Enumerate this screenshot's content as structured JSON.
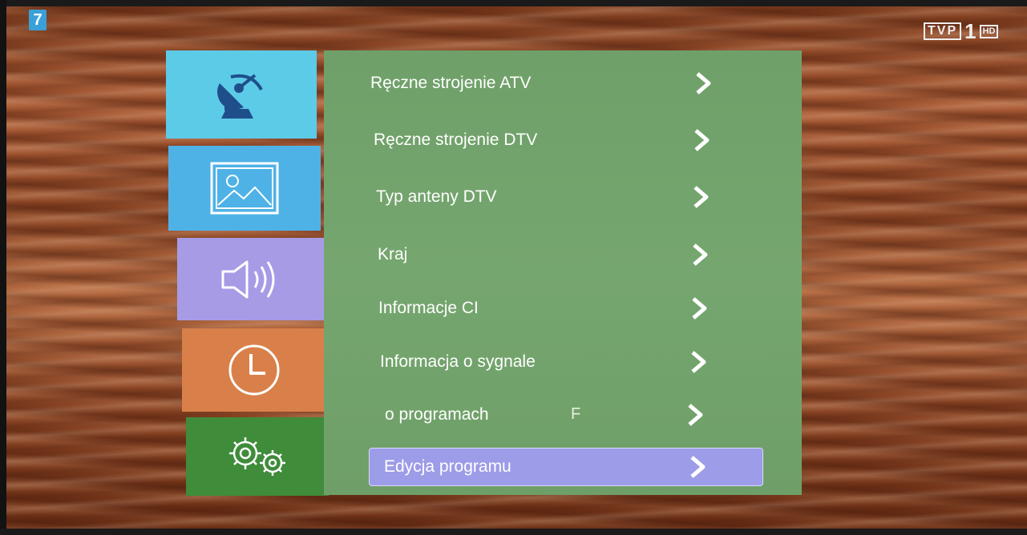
{
  "channel": {
    "number": "7"
  },
  "broadcaster_logo": {
    "name": "TVP",
    "number": "1",
    "badge": "HD"
  },
  "categories": [
    {
      "name": "satellite-dish-icon",
      "color": "#5ccbe8"
    },
    {
      "name": "picture-icon",
      "color": "#4fb2e6"
    },
    {
      "name": "speaker-icon",
      "color": "#a79be6"
    },
    {
      "name": "clock-icon",
      "color": "#d9804a"
    },
    {
      "name": "gears-icon",
      "color": "#3f8c3a"
    }
  ],
  "menu": {
    "items": [
      {
        "label": "Ręczne strojenie ATV"
      },
      {
        "label": "Ręczne strojenie DTV"
      },
      {
        "label": "Typ anteny DTV"
      },
      {
        "label": "Kraj"
      },
      {
        "label": "Informacje CI"
      },
      {
        "label": "Informacja o sygnale"
      },
      {
        "label": "o programach",
        "extra": "F"
      },
      {
        "label": "Edycja programu",
        "selected": true
      }
    ]
  },
  "colors": {
    "panel": "#72a26b",
    "selected": "#9d9ce8"
  }
}
